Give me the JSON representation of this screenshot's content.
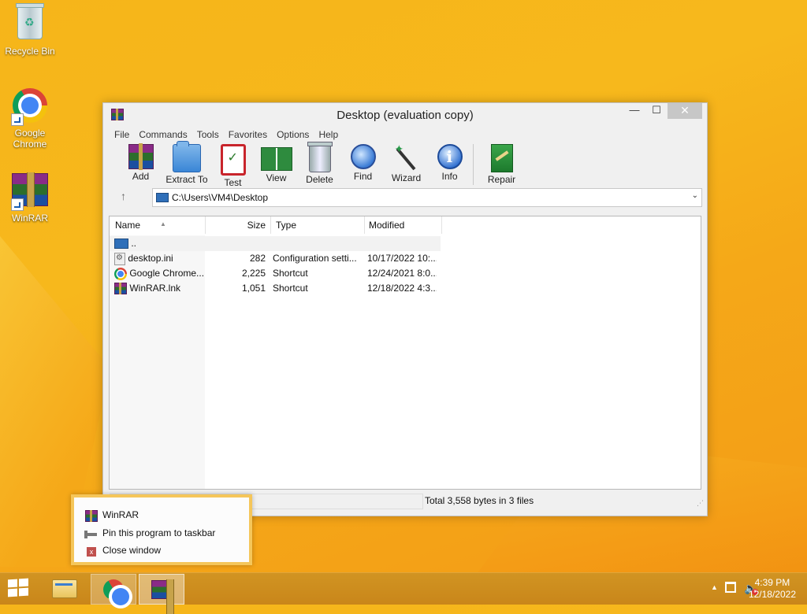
{
  "desktop": {
    "icons": [
      {
        "label": "Recycle Bin",
        "icon": "recycle-bin-icon"
      },
      {
        "label": "Google Chrome",
        "icon": "chrome-icon"
      },
      {
        "label": "WinRAR",
        "icon": "winrar-icon"
      }
    ]
  },
  "window": {
    "title": "Desktop (evaluation copy)",
    "controls": {
      "minimize": "—",
      "maximize": "☐",
      "close": "✕"
    },
    "menu": [
      "File",
      "Commands",
      "Tools",
      "Favorites",
      "Options",
      "Help"
    ],
    "toolbar": [
      {
        "label": "Add",
        "icon": "add-archive-icon"
      },
      {
        "label": "Extract To",
        "icon": "extract-folder-icon"
      },
      {
        "label": "Test",
        "icon": "test-clipboard-icon"
      },
      {
        "label": "View",
        "icon": "view-book-icon"
      },
      {
        "label": "Delete",
        "icon": "trash-icon"
      },
      {
        "label": "Find",
        "icon": "magnifier-icon"
      },
      {
        "label": "Wizard",
        "icon": "magic-wand-icon"
      },
      {
        "label": "Info",
        "icon": "info-icon"
      },
      {
        "label": "Repair",
        "icon": "repair-kit-icon"
      }
    ],
    "address": {
      "path": "C:\\Users\\VM4\\Desktop",
      "up_icon": "↑",
      "dropdown": "⌄"
    },
    "columns": {
      "name": "Name",
      "size": "Size",
      "type": "Type",
      "modified": "Modified"
    },
    "files": [
      {
        "name": "..",
        "size": "",
        "type": "",
        "modified": "",
        "icon": "parent-folder-icon"
      },
      {
        "name": "desktop.ini",
        "size": "282",
        "type": "Configuration setti...",
        "modified": "10/17/2022 10:...",
        "icon": "ini-file-icon"
      },
      {
        "name": "Google Chrome....",
        "size": "2,225",
        "type": "Shortcut",
        "modified": "12/24/2021 8:0...",
        "icon": "chrome-icon"
      },
      {
        "name": "WinRAR.lnk",
        "size": "1,051",
        "type": "Shortcut",
        "modified": "12/18/2022 4:3...",
        "icon": "winrar-icon"
      }
    ],
    "status": {
      "summary": "Total 3,558 bytes in 3 files"
    }
  },
  "jumplist": {
    "items": [
      {
        "label": "WinRAR",
        "icon": "winrar-icon"
      },
      {
        "label": "Pin this program to taskbar",
        "icon": "pin-icon"
      },
      {
        "label": "Close window",
        "icon": "close-window-icon"
      }
    ]
  },
  "taskbar": {
    "clock": {
      "time": "4:39 PM",
      "date": "12/18/2022"
    },
    "tray_expand": "▲",
    "volume_icon": "🔈"
  },
  "colors": {
    "desktop_bg": "#f6b51a",
    "taskbar": "#c9861a",
    "jumplist_border": "#f5c65a",
    "close_hover": "#c7c7c7"
  }
}
